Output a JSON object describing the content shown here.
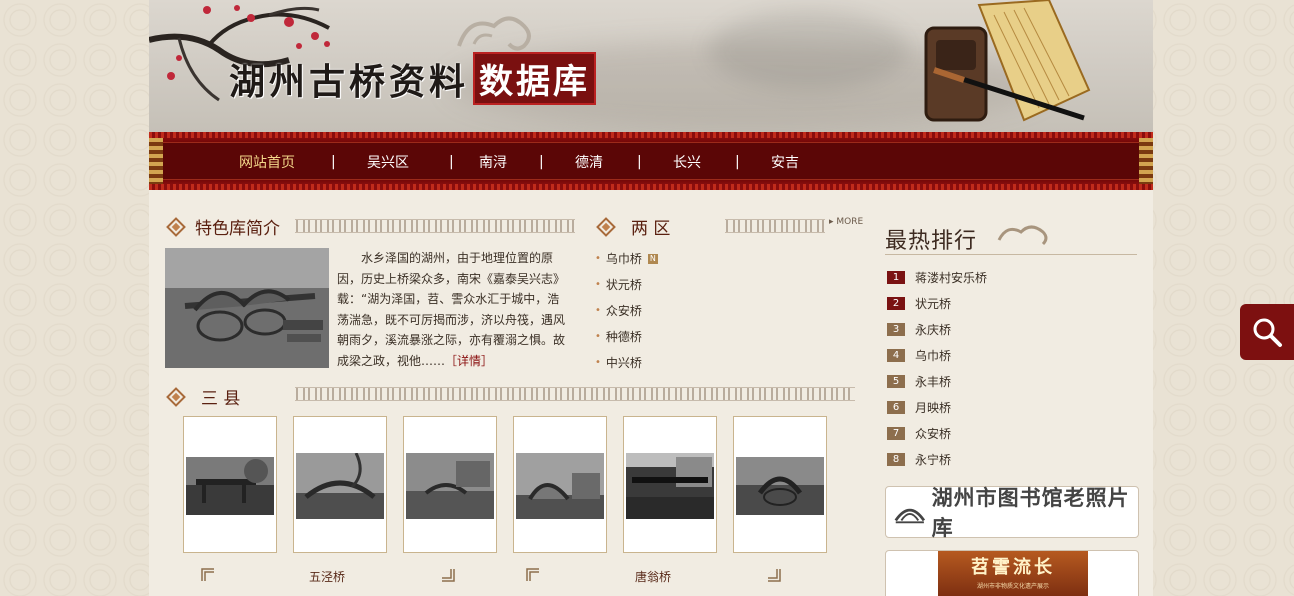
{
  "site": {
    "logo_main": "湖州古桥资料",
    "logo_highlight": "数据库"
  },
  "nav": {
    "items": [
      {
        "label": "网站首页",
        "active": true
      },
      {
        "label": "吴兴区"
      },
      {
        "label": "南浔"
      },
      {
        "label": "德清"
      },
      {
        "label": "长兴"
      },
      {
        "label": "安吉"
      }
    ],
    "separator": "|"
  },
  "intro": {
    "title": "特色库简介",
    "text": "水乡泽国的湖州，由于地理位置的原因，历史上桥梁众多，南宋《嘉泰吴兴志》载：“湖为泽国，苕、霅众水汇于城中，浩荡湍急，既不可厉揭而涉，济以舟筏，遇风朝雨夕，溪流暴涨之际，亦有覆溺之惧。故成梁之政，视他……",
    "more_label": "［详情］"
  },
  "two_districts": {
    "title": "两 区",
    "more_label": "MORE",
    "new_badge": "N",
    "items": [
      "乌巾桥",
      "状元桥",
      "众安桥",
      "种德桥",
      "中兴桥"
    ]
  },
  "three_counties": {
    "title": "三 县",
    "captions": [
      "五泾桥",
      "唐翁桥"
    ]
  },
  "hot": {
    "title": "最热排行",
    "items": [
      {
        "rank": "1",
        "name": "蒋溇村安乐桥"
      },
      {
        "rank": "2",
        "name": "状元桥"
      },
      {
        "rank": "3",
        "name": "永庆桥"
      },
      {
        "rank": "4",
        "name": "乌巾桥"
      },
      {
        "rank": "5",
        "name": "永丰桥"
      },
      {
        "rank": "6",
        "name": "月映桥"
      },
      {
        "rank": "7",
        "name": "众安桥"
      },
      {
        "rank": "8",
        "name": "永宁桥"
      }
    ]
  },
  "ads": {
    "library_photo": "湖州市图书馆老照片库",
    "zhaxi_title": "苕霅流长",
    "zhaxi_sub": "湖州市非物质文化遗产展示"
  },
  "colors": {
    "nav_red": "#5a0404",
    "rank_top": "#7a1212",
    "rank_rest": "#8d6e4d",
    "accent_gold": "#f3d78a"
  },
  "icons": {
    "search": "search-icon",
    "section_marker": "diamond-icon"
  }
}
